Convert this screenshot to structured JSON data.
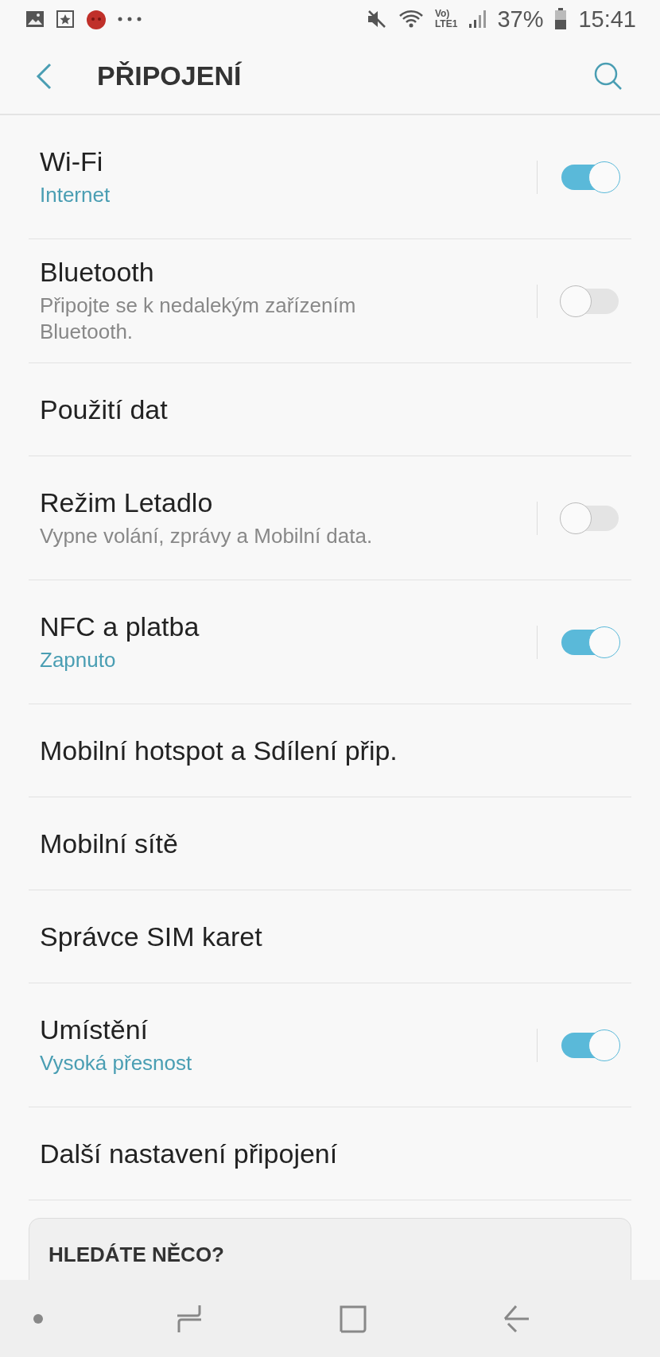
{
  "status_bar": {
    "volte": "Vo)",
    "network": "LTE1",
    "battery": "37%",
    "time": "15:41"
  },
  "header": {
    "title": "PŘIPOJENÍ"
  },
  "items": [
    {
      "kind": "toggle",
      "title": "Wi-Fi",
      "subtitle": "Internet",
      "subtitle_accent": true,
      "on": true
    },
    {
      "kind": "toggle",
      "title": "Bluetooth",
      "subtitle": "Připojte se k nedalekým zařízením Bluetooth.",
      "subtitle_accent": false,
      "on": false
    },
    {
      "kind": "plain",
      "title": "Použití dat"
    },
    {
      "kind": "toggle",
      "title": "Režim Letadlo",
      "subtitle": "Vypne volání, zprávy a Mobilní data.",
      "subtitle_accent": false,
      "on": false
    },
    {
      "kind": "toggle",
      "title": "NFC a platba",
      "subtitle": "Zapnuto",
      "subtitle_accent": true,
      "on": true
    },
    {
      "kind": "plain",
      "title": "Mobilní hotspot a Sdílení přip."
    },
    {
      "kind": "plain",
      "title": "Mobilní sítě"
    },
    {
      "kind": "plain",
      "title": "Správce SIM karet"
    },
    {
      "kind": "toggle",
      "title": "Umístění",
      "subtitle": "Vysoká přesnost",
      "subtitle_accent": true,
      "on": true
    },
    {
      "kind": "plain",
      "title": "Další nastavení připojení"
    }
  ],
  "suggestion_card": {
    "heading": "HLEDÁTE NĚCO?"
  }
}
